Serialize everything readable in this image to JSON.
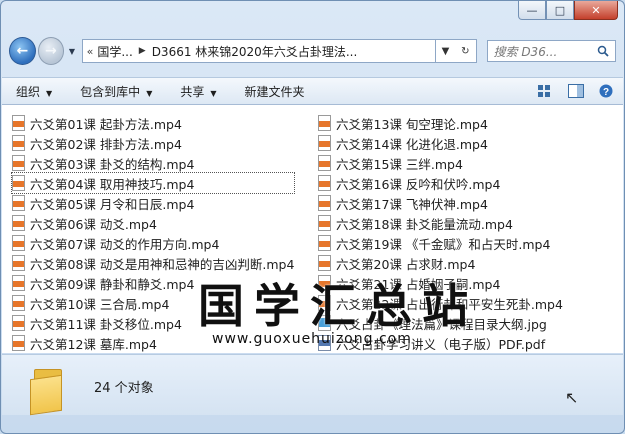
{
  "window": {
    "caption_buttons": {
      "minimize": "—",
      "maximize": "□",
      "close": "✕"
    }
  },
  "nav": {
    "back_glyph": "←",
    "forward_glyph": "→",
    "dropdown_glyph": "▼",
    "address": {
      "prefix_glyph": "«",
      "crumbs": [
        "国学...",
        "D3661 林来锦2020年六爻占卦理法..."
      ],
      "separator": "▶",
      "dropdown_glyph": "▼",
      "refresh_glyph": "↻"
    },
    "search_placeholder": "搜索 D36...",
    "search_icon": "magnifier-icon"
  },
  "toolbar": {
    "organize": "组织",
    "include_in_library": "包含到库中",
    "share": "共享",
    "new_folder": "新建文件夹",
    "dropdown_glyph": "▼",
    "view_icon": "view-options-icon",
    "preview_icon": "preview-pane-icon",
    "help_icon": "help-icon",
    "help_glyph": "?"
  },
  "files": {
    "left": [
      {
        "name": "六爻第01课 起卦方法.mp4",
        "type": "mp4"
      },
      {
        "name": "六爻第02课 排卦方法.mp4",
        "type": "mp4"
      },
      {
        "name": "六爻第03课 卦爻的结构.mp4",
        "type": "mp4"
      },
      {
        "name": "六爻第04课 取用神技巧.mp4",
        "type": "mp4",
        "selected": true
      },
      {
        "name": "六爻第05课 月令和日辰.mp4",
        "type": "mp4"
      },
      {
        "name": "六爻第06课  动爻.mp4",
        "type": "mp4"
      },
      {
        "name": "六爻第07课  动爻的作用方向.mp4",
        "type": "mp4"
      },
      {
        "name": "六爻第08课  动爻是用神和忌神的吉凶判断.mp4",
        "type": "mp4"
      },
      {
        "name": "六爻第09课   静卦和静爻.mp4",
        "type": "mp4"
      },
      {
        "name": "六爻第10课   三合局.mp4",
        "type": "mp4"
      },
      {
        "name": "六爻第11课  卦爻移位.mp4",
        "type": "mp4"
      },
      {
        "name": "六爻第12课   墓库.mp4",
        "type": "mp4"
      }
    ],
    "right": [
      {
        "name": "六爻第13课   旬空理论.mp4",
        "type": "mp4"
      },
      {
        "name": "六爻第14课   化进化退.mp4",
        "type": "mp4"
      },
      {
        "name": "六爻第15课   三绊.mp4",
        "type": "mp4"
      },
      {
        "name": "六爻第16课   反吟和伏吟.mp4",
        "type": "mp4"
      },
      {
        "name": "六爻第17课   飞神伏神.mp4",
        "type": "mp4"
      },
      {
        "name": "六爻第18课   卦爻能量流动.mp4",
        "type": "mp4"
      },
      {
        "name": "六爻第19课  《千金赋》和占天时.mp4",
        "type": "mp4"
      },
      {
        "name": "六爻第20课   占求财.mp4",
        "type": "mp4"
      },
      {
        "name": "六爻第21课   占婚姻子嗣.mp4",
        "type": "mp4"
      },
      {
        "name": "六爻第22课   占出行卦和平安生死卦.mp4",
        "type": "mp4"
      },
      {
        "name": "六爻占卦《理法篇》课程目录大纲.jpg",
        "type": "jpg"
      },
      {
        "name": "六爻占卦学习讲义（电子版）PDF.pdf",
        "type": "pdf"
      }
    ]
  },
  "status": {
    "count_text": "24 个对象",
    "folder_icon": "folder-icon"
  },
  "watermark": {
    "title": "国学汇总站",
    "url": "www.guoxuehuizong.com"
  },
  "cursor_glyph": "↖"
}
